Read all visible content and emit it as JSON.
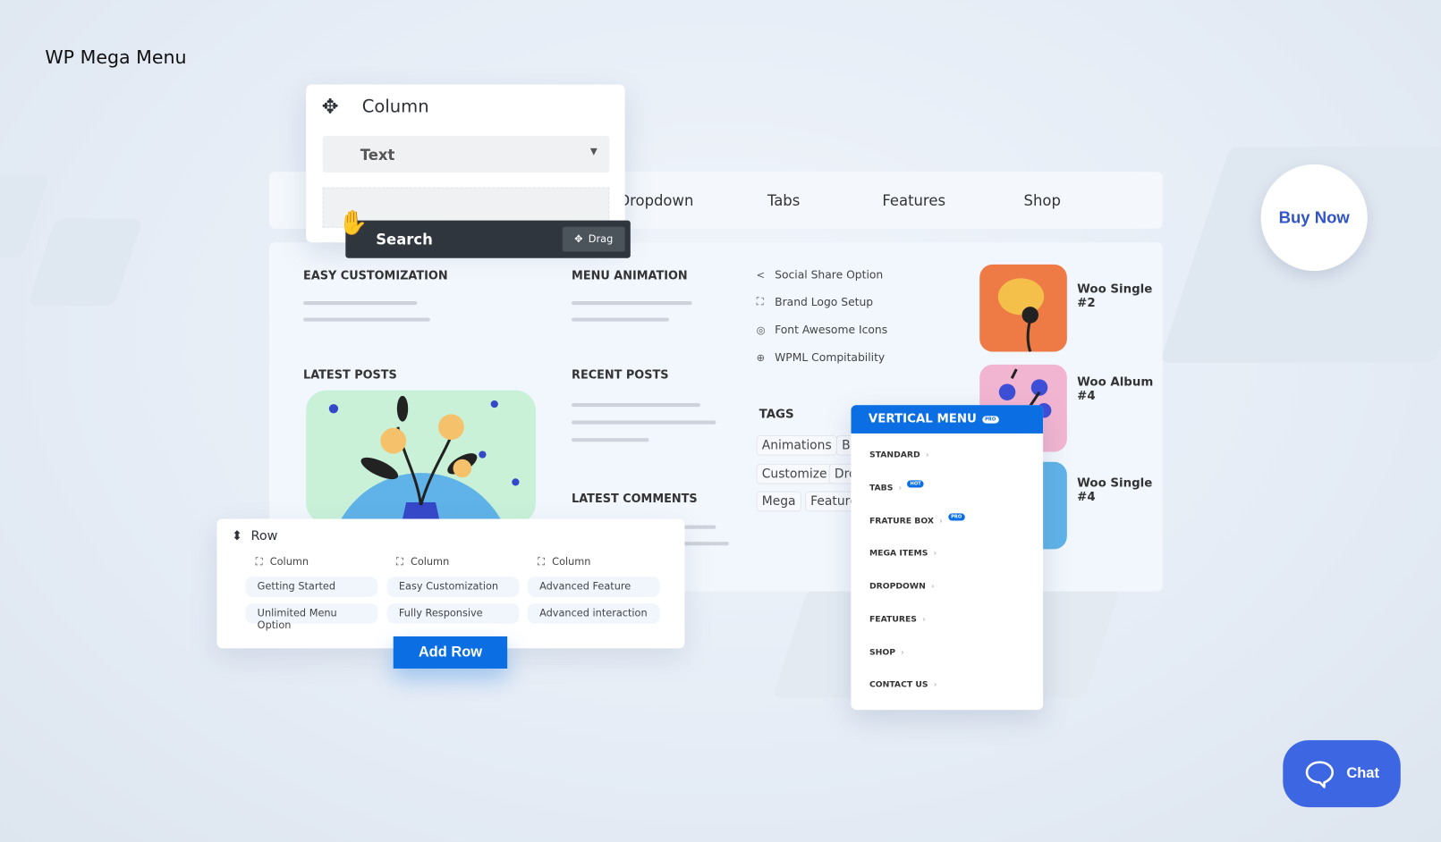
{
  "brand": "WP Mega Menu",
  "nav": {
    "items": [
      "Dropdown",
      "Tabs",
      "Features",
      "Shop"
    ]
  },
  "column_panel": {
    "title": "Column",
    "select_value": "Text",
    "drag_item": "Search",
    "drag_label": "Drag"
  },
  "sections": {
    "easy": "EASY CUSTOMIZATION",
    "anim": "MENU ANIMATION",
    "latest_posts": "LATEST POSTS",
    "recent_posts": "RECENT POSTS",
    "latest_comments": "LATEST COMMENTS",
    "tags": "TAGS"
  },
  "features": [
    {
      "icon": "share-icon",
      "label": "Social Share Option"
    },
    {
      "icon": "expand-icon",
      "label": "Brand Logo Setup"
    },
    {
      "icon": "font-awesome-icon",
      "label": "Font Awesome Icons"
    },
    {
      "icon": "wpml-icon",
      "label": "WPML Compitability"
    }
  ],
  "tags": [
    "Animations",
    "B",
    "Customize",
    "Dro",
    "Mega",
    "Feature"
  ],
  "products": [
    "Woo Single #2",
    "Woo Album #4",
    "Woo Single #4"
  ],
  "row_panel": {
    "title": "Row",
    "column_label": "Column",
    "cells": [
      [
        "Getting Started",
        "Easy Customization",
        "Advanced Feature"
      ],
      [
        "Unlimited Menu Option",
        "Fully Responsive",
        "Advanced interaction"
      ]
    ],
    "add_row": "Add Row"
  },
  "vertical_menu": {
    "title": "VERTICAL MENU",
    "title_badge": "PRO",
    "items": [
      {
        "label": "STANDARD"
      },
      {
        "label": "TABS",
        "badge": "HOT"
      },
      {
        "label": "FRATURE BOX",
        "badge": "PRO"
      },
      {
        "label": "MEGA ITEMS"
      },
      {
        "label": "DROPDOWN"
      },
      {
        "label": "FEATURES"
      },
      {
        "label": "SHOP"
      },
      {
        "label": "CONTACT US"
      }
    ]
  },
  "buy_now": "Buy Now",
  "chat": "Chat",
  "colors": {
    "accent": "#0b6fe3",
    "buy_text": "#3154c8",
    "chat_bg": "#3d67e2",
    "drag_bar": "#2f363d"
  }
}
